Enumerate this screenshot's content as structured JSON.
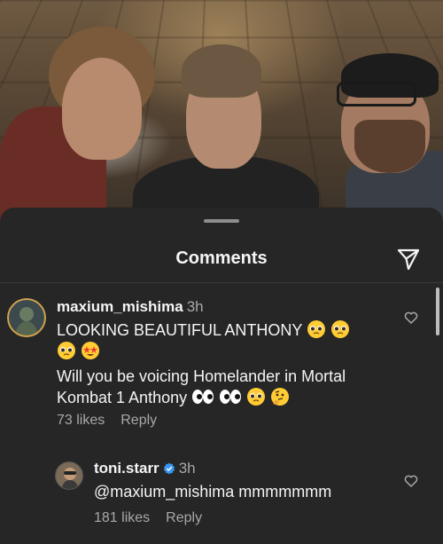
{
  "sheet": {
    "title": "Comments"
  },
  "comments": [
    {
      "username": "maxium_mishima",
      "time": "3h",
      "line1": "LOOKING BEAUTIFUL ANTHONY",
      "line3": "Will you be voicing Homelander in Mortal",
      "line4": "Kombat 1 Anthony",
      "likes": "73 likes",
      "reply": "Reply"
    },
    {
      "username": "toni.starr",
      "time": "3h",
      "text": "@maxium_mishima mmmmmmm",
      "likes": "181 likes",
      "reply": "Reply"
    }
  ],
  "colors": {
    "sheet_bg": "#262626",
    "secondary_text": "#a8a8a8",
    "verified": "#3897f0",
    "emoji": "#ffcc33"
  },
  "icons": [
    "send-icon",
    "heart-outline-icon",
    "verified-badge-icon",
    "pleading-face-emoji",
    "star-struck-emoji",
    "eyes-emoji",
    "thinking-face-emoji"
  ]
}
